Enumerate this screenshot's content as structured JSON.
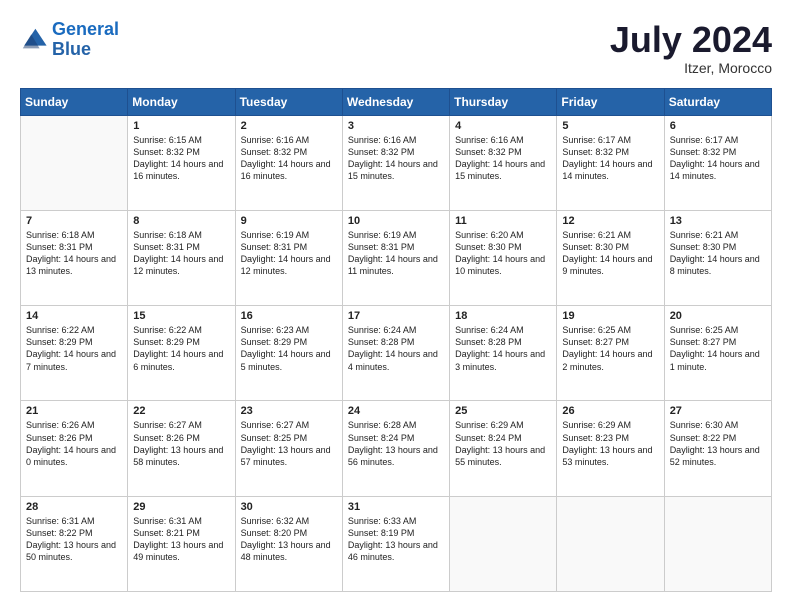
{
  "logo": {
    "line1": "General",
    "line2": "Blue"
  },
  "title": "July 2024",
  "location": "Itzer, Morocco",
  "weekdays": [
    "Sunday",
    "Monday",
    "Tuesday",
    "Wednesday",
    "Thursday",
    "Friday",
    "Saturday"
  ],
  "weeks": [
    [
      {
        "day": null
      },
      {
        "day": "1",
        "sunrise": "6:15 AM",
        "sunset": "8:32 PM",
        "daylight": "14 hours and 16 minutes."
      },
      {
        "day": "2",
        "sunrise": "6:16 AM",
        "sunset": "8:32 PM",
        "daylight": "14 hours and 16 minutes."
      },
      {
        "day": "3",
        "sunrise": "6:16 AM",
        "sunset": "8:32 PM",
        "daylight": "14 hours and 15 minutes."
      },
      {
        "day": "4",
        "sunrise": "6:16 AM",
        "sunset": "8:32 PM",
        "daylight": "14 hours and 15 minutes."
      },
      {
        "day": "5",
        "sunrise": "6:17 AM",
        "sunset": "8:32 PM",
        "daylight": "14 hours and 14 minutes."
      },
      {
        "day": "6",
        "sunrise": "6:17 AM",
        "sunset": "8:32 PM",
        "daylight": "14 hours and 14 minutes."
      }
    ],
    [
      {
        "day": "7",
        "sunrise": "6:18 AM",
        "sunset": "8:31 PM",
        "daylight": "14 hours and 13 minutes."
      },
      {
        "day": "8",
        "sunrise": "6:18 AM",
        "sunset": "8:31 PM",
        "daylight": "14 hours and 12 minutes."
      },
      {
        "day": "9",
        "sunrise": "6:19 AM",
        "sunset": "8:31 PM",
        "daylight": "14 hours and 12 minutes."
      },
      {
        "day": "10",
        "sunrise": "6:19 AM",
        "sunset": "8:31 PM",
        "daylight": "14 hours and 11 minutes."
      },
      {
        "day": "11",
        "sunrise": "6:20 AM",
        "sunset": "8:30 PM",
        "daylight": "14 hours and 10 minutes."
      },
      {
        "day": "12",
        "sunrise": "6:21 AM",
        "sunset": "8:30 PM",
        "daylight": "14 hours and 9 minutes."
      },
      {
        "day": "13",
        "sunrise": "6:21 AM",
        "sunset": "8:30 PM",
        "daylight": "14 hours and 8 minutes."
      }
    ],
    [
      {
        "day": "14",
        "sunrise": "6:22 AM",
        "sunset": "8:29 PM",
        "daylight": "14 hours and 7 minutes."
      },
      {
        "day": "15",
        "sunrise": "6:22 AM",
        "sunset": "8:29 PM",
        "daylight": "14 hours and 6 minutes."
      },
      {
        "day": "16",
        "sunrise": "6:23 AM",
        "sunset": "8:29 PM",
        "daylight": "14 hours and 5 minutes."
      },
      {
        "day": "17",
        "sunrise": "6:24 AM",
        "sunset": "8:28 PM",
        "daylight": "14 hours and 4 minutes."
      },
      {
        "day": "18",
        "sunrise": "6:24 AM",
        "sunset": "8:28 PM",
        "daylight": "14 hours and 3 minutes."
      },
      {
        "day": "19",
        "sunrise": "6:25 AM",
        "sunset": "8:27 PM",
        "daylight": "14 hours and 2 minutes."
      },
      {
        "day": "20",
        "sunrise": "6:25 AM",
        "sunset": "8:27 PM",
        "daylight": "14 hours and 1 minute."
      }
    ],
    [
      {
        "day": "21",
        "sunrise": "6:26 AM",
        "sunset": "8:26 PM",
        "daylight": "14 hours and 0 minutes."
      },
      {
        "day": "22",
        "sunrise": "6:27 AM",
        "sunset": "8:26 PM",
        "daylight": "13 hours and 58 minutes."
      },
      {
        "day": "23",
        "sunrise": "6:27 AM",
        "sunset": "8:25 PM",
        "daylight": "13 hours and 57 minutes."
      },
      {
        "day": "24",
        "sunrise": "6:28 AM",
        "sunset": "8:24 PM",
        "daylight": "13 hours and 56 minutes."
      },
      {
        "day": "25",
        "sunrise": "6:29 AM",
        "sunset": "8:24 PM",
        "daylight": "13 hours and 55 minutes."
      },
      {
        "day": "26",
        "sunrise": "6:29 AM",
        "sunset": "8:23 PM",
        "daylight": "13 hours and 53 minutes."
      },
      {
        "day": "27",
        "sunrise": "6:30 AM",
        "sunset": "8:22 PM",
        "daylight": "13 hours and 52 minutes."
      }
    ],
    [
      {
        "day": "28",
        "sunrise": "6:31 AM",
        "sunset": "8:22 PM",
        "daylight": "13 hours and 50 minutes."
      },
      {
        "day": "29",
        "sunrise": "6:31 AM",
        "sunset": "8:21 PM",
        "daylight": "13 hours and 49 minutes."
      },
      {
        "day": "30",
        "sunrise": "6:32 AM",
        "sunset": "8:20 PM",
        "daylight": "13 hours and 48 minutes."
      },
      {
        "day": "31",
        "sunrise": "6:33 AM",
        "sunset": "8:19 PM",
        "daylight": "13 hours and 46 minutes."
      },
      {
        "day": null
      },
      {
        "day": null
      },
      {
        "day": null
      }
    ]
  ]
}
